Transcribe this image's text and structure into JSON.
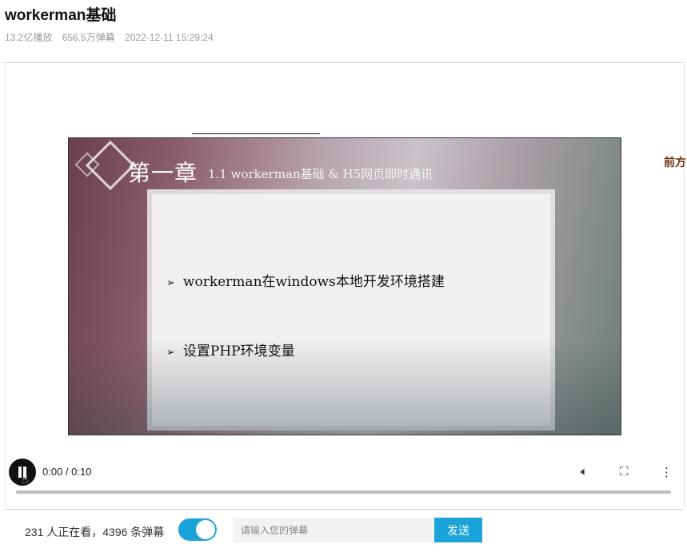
{
  "header": {
    "title": "workerman基础",
    "plays": "13.2亿播放",
    "danmaku_count": "656.5万弹幕",
    "date": "2022-12-11 15:29:24"
  },
  "video": {
    "slide": {
      "chapter": "第一章",
      "subtitle": "1.1 workerman基础 & H5网页即时通讯",
      "bullets": [
        "workerman在windows本地开发环境搭建",
        "设置PHP环境变量"
      ],
      "bullet_arrow": "➢"
    },
    "side_text": "前方",
    "time": "0:00 / 0:10",
    "progress": 0,
    "icons": {
      "play_pause": "pause-icon",
      "volume": "volume-icon",
      "fullscreen": "fullscreen-icon",
      "more": "more-vertical-icon"
    }
  },
  "danmaku_bar": {
    "viewers_text": "231 人正在看，4396 条弹幕",
    "toggle_on": true,
    "toggle_color": "#1aa3d9",
    "input_placeholder": "请输入您的弹幕",
    "send_label": "发送"
  }
}
